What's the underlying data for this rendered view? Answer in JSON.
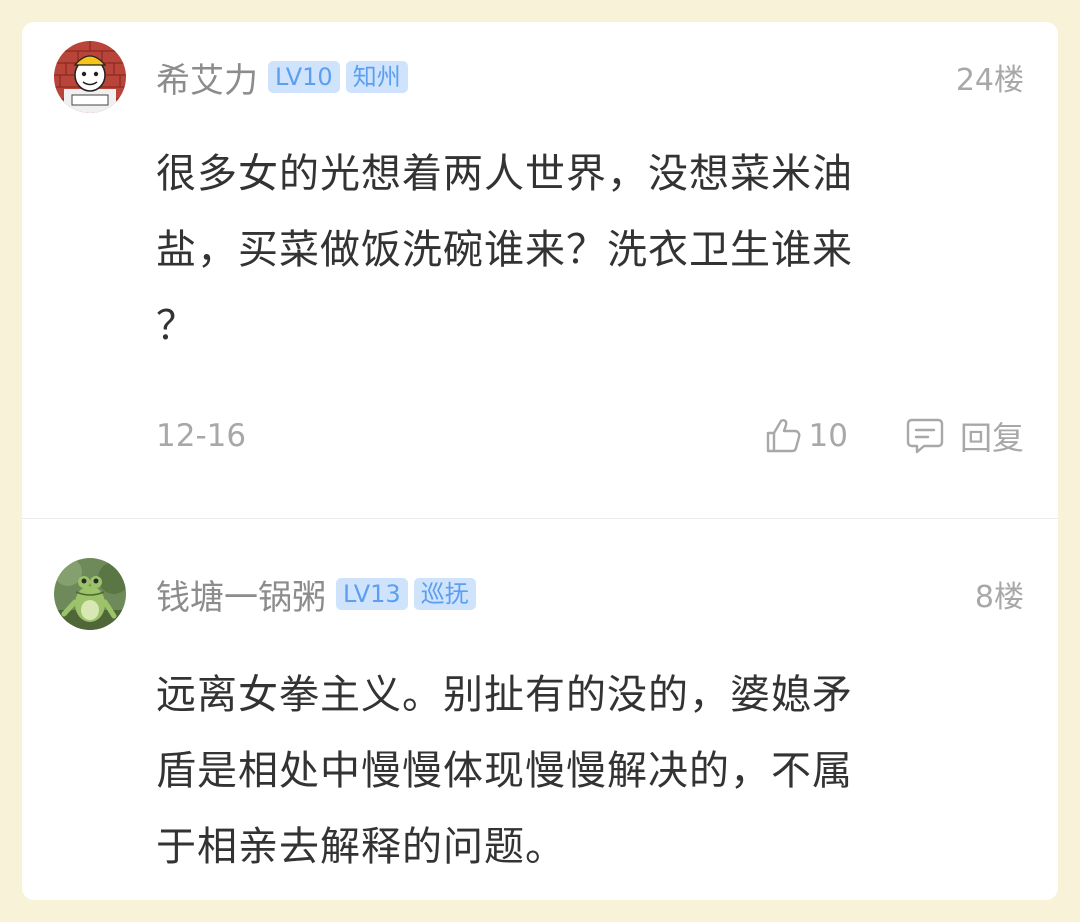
{
  "comments": [
    {
      "username": "希艾力",
      "badges": [
        "LV10",
        "知州"
      ],
      "floor": "24楼",
      "content_lines": [
        "很多女的光想着两人世界，没想菜米油",
        "盐，买菜做饭洗碗谁来？洗衣卫生谁来",
        "？"
      ],
      "date": "12-16",
      "likes": "10",
      "reply_label": "回复",
      "avatar_icon": "cartoon-worker-avatar-icon"
    },
    {
      "username": "钱塘一锅粥",
      "badges": [
        "LV13",
        "巡抚"
      ],
      "floor": "8楼",
      "content_lines": [
        "远离女拳主义。别扯有的没的，婆媳矛",
        "盾是相处中慢慢体现慢慢解决的，不属",
        "于相亲去解释的问题。"
      ],
      "avatar_icon": "frog-avatar-icon"
    }
  ],
  "colors": {
    "page_background": "#f8f3d8",
    "card_background": "#ffffff",
    "badge_background": "#cfe4fc",
    "badge_text": "#5c9ef0",
    "muted_text": "#a8a8a8",
    "body_text": "#333333"
  },
  "icons": {
    "like": "thumbs-up-icon",
    "reply": "comment-bubble-icon"
  }
}
